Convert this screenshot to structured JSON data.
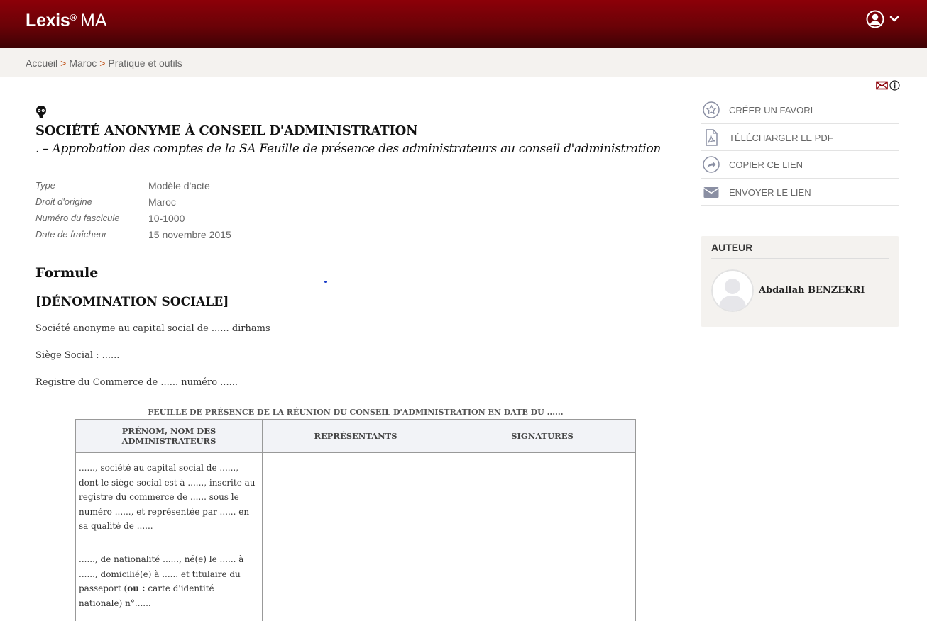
{
  "header": {
    "brand": "Lexis",
    "brand_mark": "®",
    "region": "MA",
    "user_icon": "user-circle-icon",
    "menu_icon": "chevron-down-icon",
    "colors": {
      "bar_top": "#8c0008",
      "bar_bottom": "#3d0204"
    }
  },
  "breadcrumb": {
    "items": [
      "Accueil",
      "Maroc",
      "Pratique et outils"
    ],
    "separator": ">"
  },
  "document": {
    "title": "SOCIÉTÉ ANONYME À CONSEIL D'ADMINISTRATION",
    "subtitle": ". – Approbation des comptes de la SA Feuille de présence des administrateurs au conseil d'administration",
    "meta": [
      {
        "key": "Type",
        "value": "Modèle d'acte"
      },
      {
        "key": "Droit d'origine",
        "value": "Maroc"
      },
      {
        "key": "Numéro du fascicule",
        "value": "10-1000"
      },
      {
        "key": "Date de fraîcheur",
        "value": "15 novembre 2015"
      }
    ],
    "section_heading": "Formule",
    "company_heading": "[DÉNOMINATION SOCIALE]",
    "paragraphs": [
      "Société anonyme au capital social de ...... dirhams",
      "Siège Social : ......",
      "Registre du Commerce de ...... numéro ......"
    ],
    "table": {
      "caption": "FEUILLE DE PRÉSENCE DE LA RÉUNION DU CONSEIL D'ADMINISTRATION EN DATE DU ......",
      "headers": [
        "PRÉNOM, NOM DES ADMINISTRATEURS",
        "REPRÉSENTANTS",
        "SIGNATURES"
      ],
      "rows": [
        {
          "col1_text": "......, société au capital social de ......, dont le siège social est à ......, inscrite au registre du commerce de ...... sous le numéro ......, et représentée par ...... en sa qualité de ......",
          "col2": "",
          "col3": ""
        },
        {
          "col1_before": "......, de nationalité ......, né(e) le ...... à ......, domicilié(e) à ...... et titulaire du passeport (",
          "col1_bold": "ou :",
          "col1_after": " carte d'identité nationale) n°......",
          "col2": "",
          "col3": ""
        }
      ]
    }
  },
  "actions": [
    {
      "label": "CRÉER UN FAVORI",
      "icon": "star-icon"
    },
    {
      "label": "TÉLÉCHARGER LE PDF",
      "icon": "pdf-icon"
    },
    {
      "label": "COPIER CE LIEN",
      "icon": "share-icon"
    },
    {
      "label": "ENVOYER LE LIEN",
      "icon": "envelope-icon"
    }
  ],
  "author": {
    "heading": "AUTEUR",
    "name": "Abdallah BENZEKRI"
  }
}
